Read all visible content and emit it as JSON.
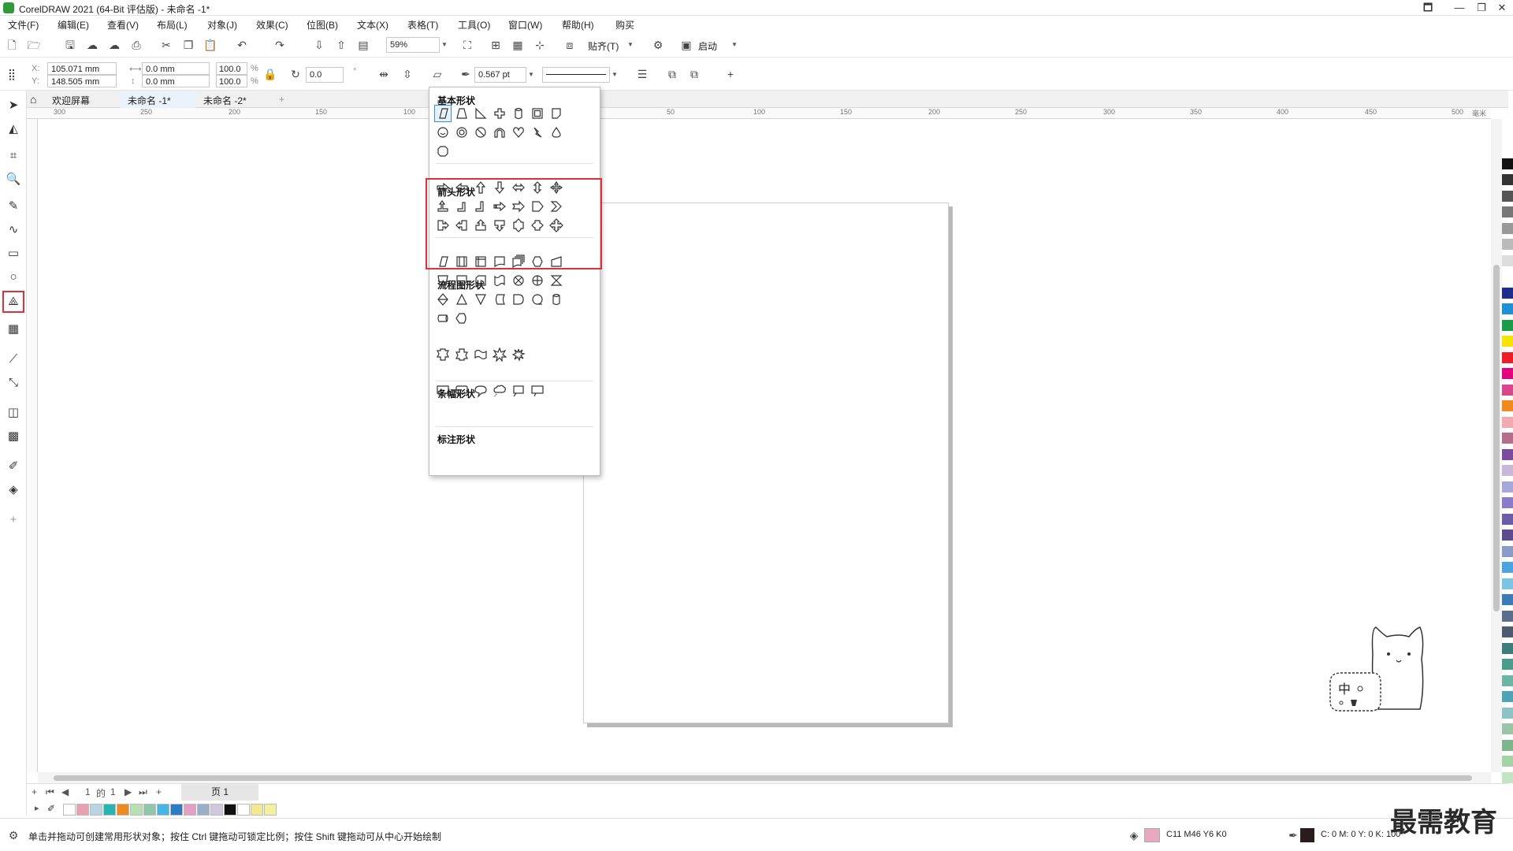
{
  "window": {
    "title": "CorelDRAW 2021 (64-Bit 评估版) - 未命名 -1*",
    "controls": [
      "🗖",
      "—",
      "❐",
      "✕"
    ]
  },
  "menu": [
    "文件(F)",
    "编辑(E)",
    "查看(V)",
    "布局(L)",
    "对象(J)",
    "效果(C)",
    "位图(B)",
    "文本(X)",
    "表格(T)",
    "工具(O)",
    "窗口(W)",
    "帮助(H)",
    "购买"
  ],
  "toolbar": {
    "zoom": "59%",
    "snap_label": "贴齐(T)",
    "launch_label": "启动"
  },
  "propbar": {
    "x_label": "X:",
    "x_value": "105.071 mm",
    "y_label": "Y:",
    "y_value": "148.505 mm",
    "w_value": "0.0 mm",
    "h_value": "0.0 mm",
    "scale_w": "100.0",
    "scale_h": "100.0",
    "percent": "%",
    "rotation": "0.0",
    "outline_width": "0.567 pt"
  },
  "tabs": [
    {
      "label": "欢迎屏幕"
    },
    {
      "label": "未命名 -1*"
    },
    {
      "label": "未命名 -2*"
    }
  ],
  "ruler": {
    "ticks": [
      "300",
      "250",
      "200",
      "150",
      "100",
      "50",
      "100",
      "150",
      "200",
      "250",
      "300",
      "350",
      "400",
      "450",
      "500"
    ],
    "unit": "毫米"
  },
  "flyout": {
    "sections": [
      {
        "title": "基本形状"
      },
      {
        "title": "箭头形状"
      },
      {
        "title": "流程图形状"
      },
      {
        "title": "条幅形状"
      },
      {
        "title": "标注形状"
      }
    ]
  },
  "pagenav": {
    "current": "1",
    "of_label": "的",
    "total": "1",
    "page_tab": "页 1"
  },
  "mascot": {
    "text": "中"
  },
  "status": {
    "hint": "单击并拖动可创建常用形状对象；按住 Ctrl 键拖动可锁定比例；按住 Shift 键拖动可从中心开始绘制",
    "fill_color": "C11 M46 Y6 K0",
    "outline_color": "C: 0 M: 0 Y: 0 K: 100"
  },
  "watermark": "最需教育",
  "colors": {
    "accent": "#1e90d6",
    "highlight": "#e0303a",
    "fill": "#e8a8c0"
  },
  "doc_palette": [
    "#ffffff",
    "#e9a0b0",
    "#b9d4e3",
    "#26b5b0",
    "#f08a1e",
    "#b9e0b0",
    "#8ec8a8",
    "#46b6e4",
    "#2a7cc8",
    "#e4a0c4",
    "#9ab0c8",
    "#d0c8e0",
    "#111111",
    "#ffffff",
    "#f5e890",
    "#f4f0a0"
  ],
  "right_palette": [
    "#ffffff",
    "#111111",
    "#333333",
    "#555555",
    "#777777",
    "#999999",
    "#bbbbbb",
    "#dddddd",
    "#ffffff",
    "#1d2d8c",
    "#1e90d6",
    "#1a9c48",
    "#f5e400",
    "#ee1c24",
    "#e4007f",
    "#d8468c",
    "#f08a1e",
    "#f4a8b0",
    "#b86c8c",
    "#7c4c9c",
    "#c8b8d8",
    "#a8a8d8",
    "#8c7cc8",
    "#6c5ca8",
    "#5c4c8c",
    "#8a9cc4",
    "#4aa4e0",
    "#7cc4e4",
    "#3c7cb4",
    "#5c6c8c",
    "#4c5c6c",
    "#3c7c7c",
    "#4c9c8c",
    "#6cb4a4",
    "#4ca4b4",
    "#8cc4c4",
    "#9cc4a8",
    "#7cb48c",
    "#a4d4a4",
    "#c4e4c4"
  ]
}
